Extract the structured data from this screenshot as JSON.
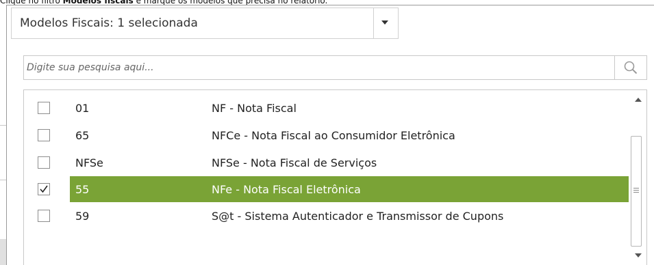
{
  "caption": {
    "prefix": "Clique no filtro ",
    "bold": "Modelos fiscais",
    "suffix": " e marque os modelos que precisa no relatório."
  },
  "filter": {
    "label": "Modelos Fiscais: 1 selecionada",
    "arrow_icon": "caret-down-icon"
  },
  "search": {
    "placeholder": "Digite sua pesquisa aqui...",
    "value": "",
    "icon": "magnifier-icon"
  },
  "models": [
    {
      "code": "01",
      "description": "NF - Nota Fiscal",
      "checked": false,
      "selected": false
    },
    {
      "code": "65",
      "description": "NFCe - Nota Fiscal ao Consumidor Eletrônica",
      "checked": false,
      "selected": false
    },
    {
      "code": "NFSe",
      "description": "NFSe - Nota Fiscal de Serviços",
      "checked": false,
      "selected": false
    },
    {
      "code": "55",
      "description": "NFe - Nota Fiscal Eletrônica",
      "checked": true,
      "selected": true
    },
    {
      "code": "59",
      "description": "S@t - Sistema Autenticador e Transmissor de Cupons",
      "checked": false,
      "selected": false
    }
  ],
  "colors": {
    "selected_row": "#7aa336",
    "selected_text": "#ffffff",
    "border": "#c8c8c8"
  }
}
